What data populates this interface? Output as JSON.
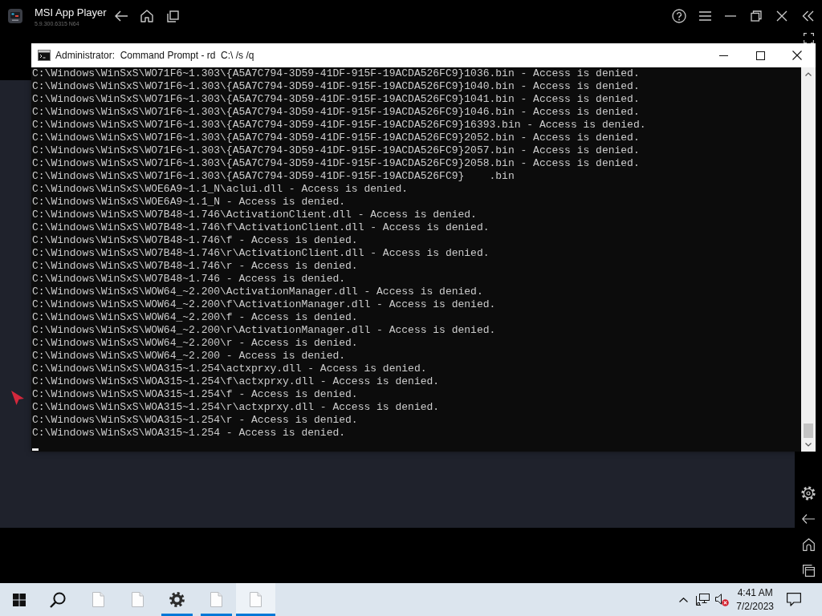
{
  "app_bar": {
    "title": "MSI App Player",
    "version": "5.9.300.6315 N64"
  },
  "console_window": {
    "title": "Administrator:  Command Prompt - rd  C:\\ /s /q",
    "lines": [
      "C:\\Windows\\WinSxS\\WO71F6~1.303\\{A5A7C794-3D59-41DF-915F-19ACDA526FC9}1036.bin - Access is denied.",
      "C:\\Windows\\WinSxS\\WO71F6~1.303\\{A5A7C794-3D59-41DF-915F-19ACDA526FC9}1040.bin - Access is denied.",
      "C:\\Windows\\WinSxS\\WO71F6~1.303\\{A5A7C794-3D59-41DF-915F-19ACDA526FC9}1041.bin - Access is denied.",
      "C:\\Windows\\WinSxS\\WO71F6~1.303\\{A5A7C794-3D59-41DF-915F-19ACDA526FC9}1046.bin - Access is denied.",
      "C:\\Windows\\WinSxS\\WO71F6~1.303\\{A5A7C794-3D59-41DF-915F-19ACDA526FC9}16393.bin - Access is denied.",
      "C:\\Windows\\WinSxS\\WO71F6~1.303\\{A5A7C794-3D59-41DF-915F-19ACDA526FC9}2052.bin - Access is denied.",
      "C:\\Windows\\WinSxS\\WO71F6~1.303\\{A5A7C794-3D59-41DF-915F-19ACDA526FC9}2057.bin - Access is denied.",
      "C:\\Windows\\WinSxS\\WO71F6~1.303\\{A5A7C794-3D59-41DF-915F-19ACDA526FC9}2058.bin - Access is denied.",
      "C:\\Windows\\WinSxS\\WO71F6~1.303\\{A5A7C794-3D59-41DF-915F-19ACDA526FC9}    .bin",
      "C:\\Windows\\WinSxS\\WOE6A9~1.1_N\\aclui.dll - Access is denied.",
      "C:\\Windows\\WinSxS\\WOE6A9~1.1_N - Access is denied.",
      "C:\\Windows\\WinSxS\\WO7B48~1.746\\ActivationClient.dll - Access is denied.",
      "C:\\Windows\\WinSxS\\WO7B48~1.746\\f\\ActivationClient.dll - Access is denied.",
      "C:\\Windows\\WinSxS\\WO7B48~1.746\\f - Access is denied.",
      "C:\\Windows\\WinSxS\\WO7B48~1.746\\r\\ActivationClient.dll - Access is denied.",
      "C:\\Windows\\WinSxS\\WO7B48~1.746\\r - Access is denied.",
      "C:\\Windows\\WinSxS\\WO7B48~1.746 - Access is denied.",
      "C:\\Windows\\WinSxS\\WOW64_~2.200\\ActivationManager.dll - Access is denied.",
      "C:\\Windows\\WinSxS\\WOW64_~2.200\\f\\ActivationManager.dll - Access is denied.",
      "C:\\Windows\\WinSxS\\WOW64_~2.200\\f - Access is denied.",
      "C:\\Windows\\WinSxS\\WOW64_~2.200\\r\\ActivationManager.dll - Access is denied.",
      "C:\\Windows\\WinSxS\\WOW64_~2.200\\r - Access is denied.",
      "C:\\Windows\\WinSxS\\WOW64_~2.200 - Access is denied.",
      "C:\\Windows\\WinSxS\\WOA315~1.254\\actxprxy.dll - Access is denied.",
      "C:\\Windows\\WinSxS\\WOA315~1.254\\f\\actxprxy.dll - Access is denied.",
      "C:\\Windows\\WinSxS\\WOA315~1.254\\f - Access is denied.",
      "C:\\Windows\\WinSxS\\WOA315~1.254\\r\\actxprxy.dll - Access is denied.",
      "C:\\Windows\\WinSxS\\WOA315~1.254\\r - Access is denied.",
      "C:\\Windows\\WinSxS\\WOA315~1.254 - Access is denied."
    ]
  },
  "taskbar": {
    "apps": [
      {
        "kind": "document",
        "running": false,
        "selected": false
      },
      {
        "kind": "document",
        "running": false,
        "selected": false
      },
      {
        "kind": "settings",
        "running": true,
        "selected": false
      },
      {
        "kind": "document",
        "running": true,
        "selected": false
      },
      {
        "kind": "document",
        "running": true,
        "selected": true
      }
    ],
    "clock": {
      "time": "4:41 AM",
      "date": "7/2/2023"
    }
  }
}
